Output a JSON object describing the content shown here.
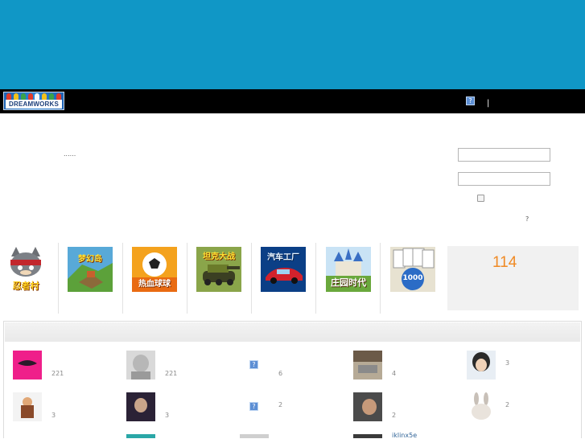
{
  "header": {
    "logo_text": "DREAMWORKS",
    "help_icon": "question-icon",
    "separator": "|",
    "banner_color": "#1097c6",
    "bar_color": "#000000"
  },
  "intro": {
    "text": "......"
  },
  "login": {
    "remember_checked": false,
    "question_text": "?"
  },
  "games": [
    {
      "title": "忍者村",
      "icon": "ninja-cat-icon"
    },
    {
      "title": "梦幻岛",
      "icon": "island-icon"
    },
    {
      "title": "热血球球",
      "icon": "soccer-icon"
    },
    {
      "title": "坦克大战",
      "icon": "tank-icon"
    },
    {
      "title": "汽车工厂",
      "icon": "car-icon"
    },
    {
      "title": "庄园时代",
      "icon": "castle-icon"
    },
    {
      "title": "1000",
      "icon": "cards-icon"
    }
  ],
  "online": {
    "count": "114",
    "accent": "#f08a24"
  },
  "users": {
    "row1": [
      {
        "num": "221",
        "icon": "pink-avatar-icon"
      },
      {
        "num": "221",
        "icon": "sketch-avatar-icon"
      },
      {
        "num": "6",
        "icon": "question-icon"
      },
      {
        "num": "4",
        "icon": "car-photo-avatar-icon"
      },
      {
        "num": "3",
        "icon": "girl-avatar-icon"
      }
    ],
    "row2": [
      {
        "num": "3",
        "icon": "warrior-avatar-icon"
      },
      {
        "num": "3",
        "icon": "dark-avatar-icon"
      },
      {
        "num": "2",
        "icon": "question-icon"
      },
      {
        "num": "2",
        "icon": "boy-avatar-icon"
      },
      {
        "num": "2",
        "icon": "bunny-avatar-icon"
      }
    ],
    "row3_name": "iklinx5e"
  }
}
